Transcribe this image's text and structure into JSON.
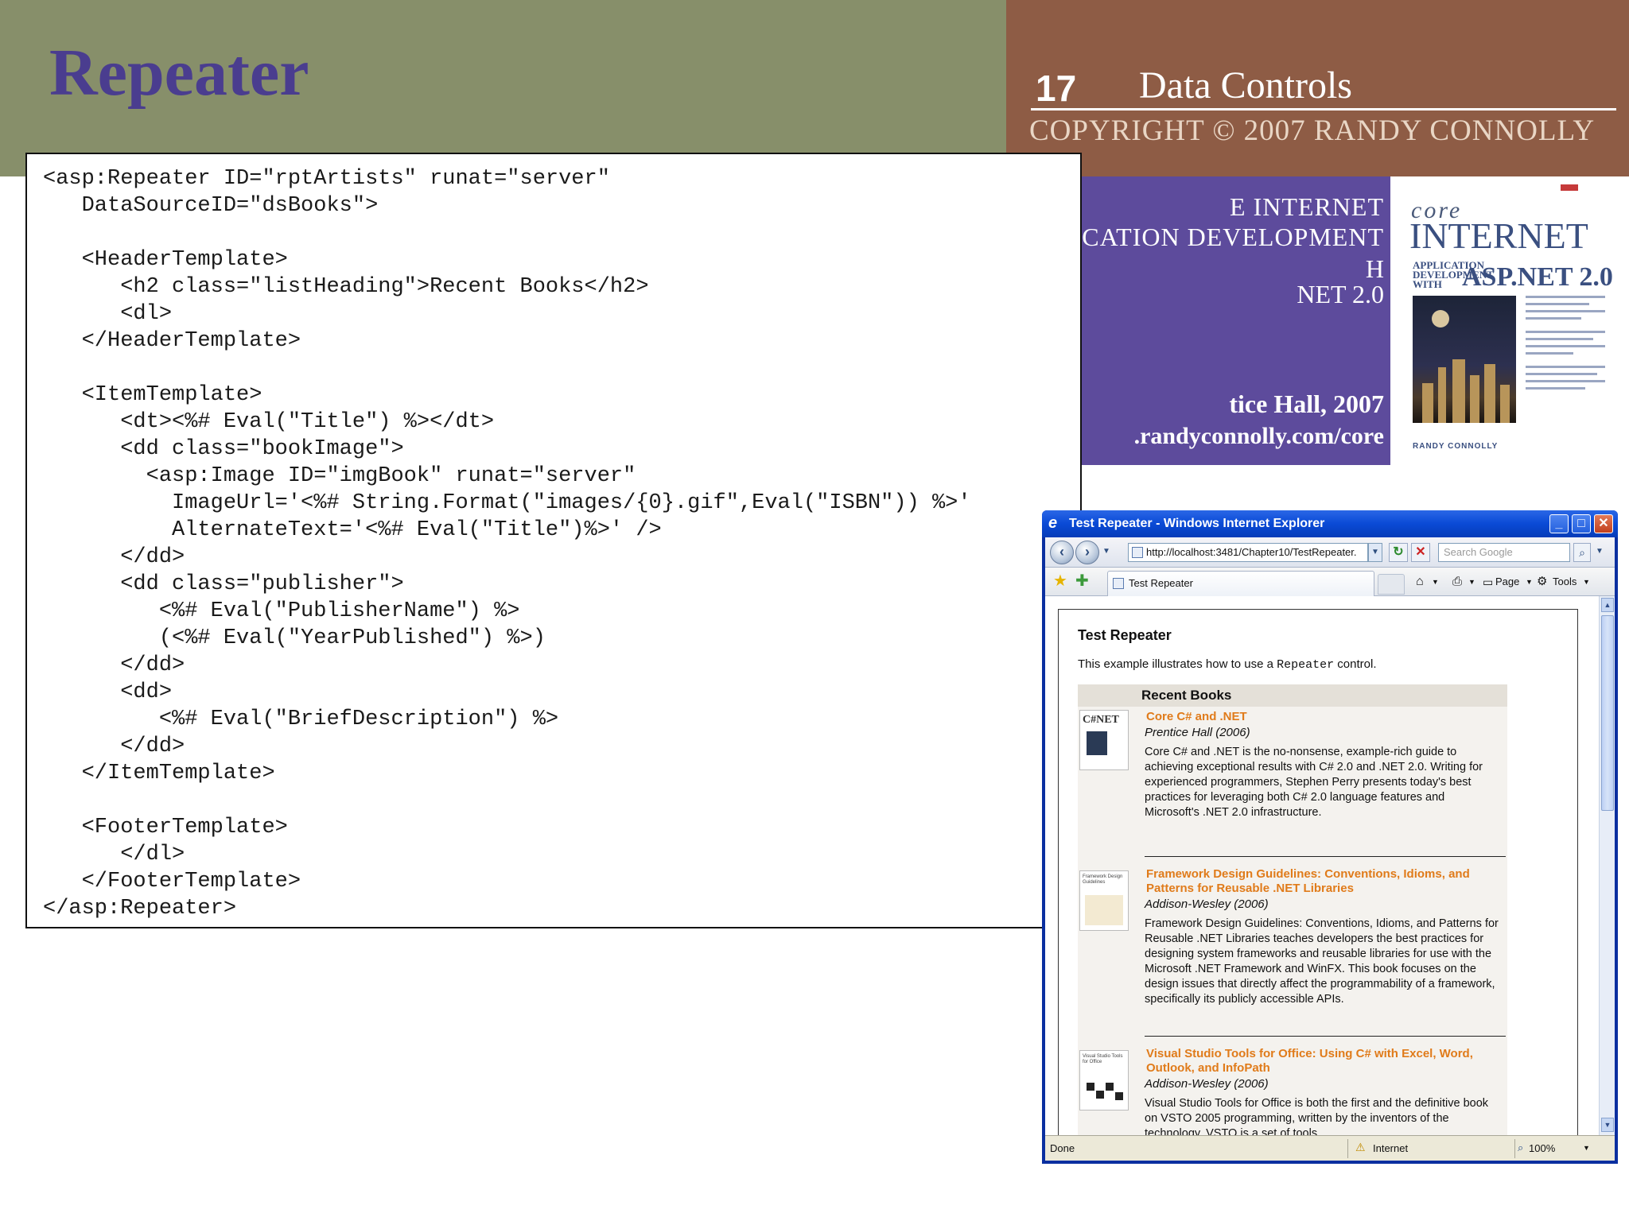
{
  "slide": {
    "title": "Repeater",
    "number": "17",
    "chapter": "Data Controls",
    "copyright": "COPYRIGHT © 2007 RANDY CONNOLLY"
  },
  "banner": {
    "line1": "E INTERNET",
    "line2": "ICATION DEVELOPMENT",
    "line3": "H",
    "line4": "NET 2.0",
    "line5": "tice Hall, 2007",
    "line6": ".randyconnolly.com/core"
  },
  "cover": {
    "core": "core",
    "internet": "INTERNET",
    "subtitle": "APPLICATION DEVELOPMENT WITH",
    "asp": "ASP.NET 2.0",
    "author": "RANDY CONNOLLY"
  },
  "code": {
    "lines": [
      "<asp:Repeater ID=\"rptArtists\" runat=\"server\"",
      "   DataSourceID=\"dsBooks\">",
      "",
      "   <HeaderTemplate>",
      "      <h2 class=\"listHeading\">Recent Books</h2>",
      "      <dl>",
      "   </HeaderTemplate>",
      "",
      "   <ItemTemplate>",
      "      <dt><%# Eval(\"Title\") %></dt>",
      "      <dd class=\"bookImage\">",
      "        <asp:Image ID=\"imgBook\" runat=\"server\"",
      "          ImageUrl='<%# String.Format(\"images/{0}.gif\",Eval(\"ISBN\")) %>'",
      "          AlternateText='<%# Eval(\"Title\")%>' />",
      "      </dd>",
      "      <dd class=\"publisher\">",
      "         <%# Eval(\"PublisherName\") %>",
      "         (<%# Eval(\"YearPublished\") %>)",
      "      </dd>",
      "      <dd>",
      "         <%# Eval(\"BriefDescription\") %>",
      "      </dd>",
      "   </ItemTemplate>",
      "",
      "   <FooterTemplate>",
      "      </dl>",
      "   </FooterTemplate>",
      "</asp:Repeater>"
    ]
  },
  "browser": {
    "window_title": "Test Repeater - Windows Internet Explorer",
    "address": "http://localhost:3481/Chapter10/TestRepeater.",
    "search_placeholder": "Search Google",
    "tab_label": "Test Repeater",
    "cmd_page": "Page",
    "cmd_tools": "Tools",
    "status_done": "Done",
    "status_zone": "Internet",
    "status_zoom": "100%",
    "page": {
      "heading": "Test Repeater",
      "intro_before": "This example illustrates how to use a ",
      "intro_code": "Repeater",
      "intro_after": " control.",
      "list_heading": "Recent Books",
      "books": [
        {
          "title": "Core C# and .NET",
          "publisher": "Prentice Hall (2006)",
          "description": "Core C# and .NET is the no-nonsense, example-rich guide to achieving exceptional results with C# 2.0 and .NET 2.0. Writing for experienced programmers, Stephen Perry presents today's best practices for leveraging both C# 2.0 language features and Microsoft's .NET 2.0 infrastructure.",
          "thumb_label": "C#NET"
        },
        {
          "title": "Framework Design Guidelines: Conventions, Idioms, and Patterns for Reusable .NET Libraries",
          "publisher": "Addison-Wesley (2006)",
          "description": "Framework Design Guidelines: Conventions, Idioms, and Patterns for Reusable .NET Libraries teaches developers the best practices for designing system frameworks and reusable libraries for use with the Microsoft .NET Framework and WinFX. This book focuses on the design issues that directly affect the programmability of a framework, specifically its publicly accessible APIs.",
          "thumb_label": "Framework Design Guidelines"
        },
        {
          "title": "Visual Studio Tools for Office: Using C# with Excel, Word, Outlook, and InfoPath",
          "publisher": "Addison-Wesley (2006)",
          "description": "Visual Studio Tools for Office is both the first and the definitive book on VSTO 2005 programming, written by the inventors of the technology. VSTO is a set of tools",
          "thumb_label": "Visual Studio Tools for Office"
        }
      ]
    }
  },
  "colors": {
    "header_left": "#878f6a",
    "header_right": "#8e5c45",
    "title": "#4a3d8f",
    "banner": "#5d4b9c",
    "book_title": "#e07b1a"
  }
}
